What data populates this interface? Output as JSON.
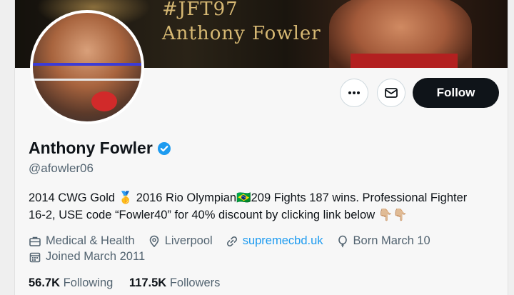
{
  "banner": {
    "hashtag": "#JFT97",
    "name_text": "Anthony Fowler"
  },
  "actions": {
    "more_label": "More",
    "message_label": "Message",
    "follow_label": "Follow"
  },
  "profile": {
    "display_name": "Anthony Fowler",
    "handle": "@afowler06",
    "bio_line1": "2014 CWG Gold 🥇 2016 Rio Olympian🇧🇷209 Fights 187 wins. Professional Fighter",
    "bio_line2": "16-2, USE code “Fowler40” for 40% discount by clicking link below 👇🏼👇🏼",
    "category": "Medical & Health",
    "location": "Liverpool",
    "website": "supremecbd.uk",
    "birthday": "Born March 10",
    "joined": "Joined March 2011"
  },
  "stats": {
    "following_count": "56.7K",
    "following_label": "Following",
    "followers_count": "117.5K",
    "followers_label": "Followers"
  },
  "colors": {
    "accent": "#1d9bf0",
    "text": "#0f1419",
    "muted": "#536471",
    "follow_bg": "#0f1419"
  }
}
